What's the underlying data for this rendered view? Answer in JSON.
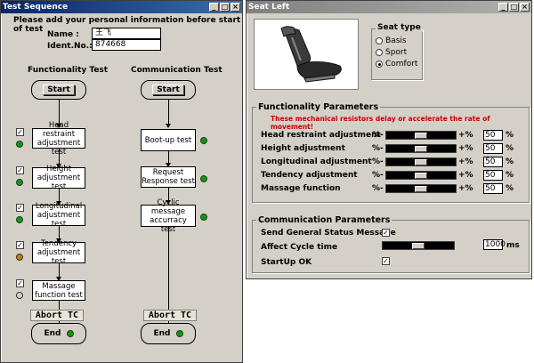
{
  "test_window": {
    "title": "Test Sequence",
    "instruction": "Please add your personal information before start of test",
    "name_label": "Name :",
    "name_value": "王飞",
    "ident_label": "Ident.No.:",
    "ident_value": "874668",
    "func_title": "Functionality Test",
    "comm_title": "Communication Test",
    "start_label": "Start",
    "end_label": "End",
    "abort_label": "Abort TC",
    "func_steps": [
      {
        "label": "Head restraint adjustment test",
        "checked": true,
        "led": "#00a000"
      },
      {
        "label": "Height adjustment test",
        "checked": true,
        "led": "#00a000"
      },
      {
        "label": "Longitudinal adjustment test",
        "checked": true,
        "led": "#00a000"
      },
      {
        "label": "Tendency adjustment test",
        "checked": true,
        "led": "#c08000"
      },
      {
        "label": "Massage function test",
        "checked": true,
        "led": "#d0d0d0"
      }
    ],
    "comm_steps": [
      {
        "label": "Boot-up test",
        "led": "#00a000"
      },
      {
        "label": "Request Response test",
        "led": "#00a000"
      },
      {
        "label": "Cyclic message accurracy test",
        "led": "#00a000"
      }
    ]
  },
  "seat_window": {
    "title": "Seat Left",
    "seat_type_label": "Seat type",
    "seat_types": [
      "Basis",
      "Sport",
      "Comfort"
    ],
    "selected_seat_type": "Comfort",
    "func_group_label": "Functionality Parameters",
    "func_warning": "These mechanical resistors delay or accelerate the rate of movement!",
    "minus_label": "%-",
    "plus_label": "+%",
    "percent_unit": "%",
    "params": [
      {
        "label": "Head restraint adjustment",
        "value": "50",
        "level": 0.5
      },
      {
        "label": "Height adjustment",
        "value": "50",
        "level": 0.5
      },
      {
        "label": "Longitudinal adjustment",
        "value": "50",
        "level": 0.5
      },
      {
        "label": "Tendency adjustment",
        "value": "50",
        "level": 0.5
      },
      {
        "label": "Massage function",
        "value": "50",
        "level": 0.5
      }
    ],
    "comm_group_label": "Communication Parameters",
    "send_status_label": "Send General Status Message",
    "affect_cycle_label": "Affect Cycle time",
    "cycle_value": "1000",
    "cycle_unit": "ms",
    "cycle_level": 0.5,
    "startup_label": "StartUp OK"
  },
  "colors": {
    "active_title": "#0a246a",
    "warning_red": "#cc0000",
    "led_green": "#00a000"
  }
}
